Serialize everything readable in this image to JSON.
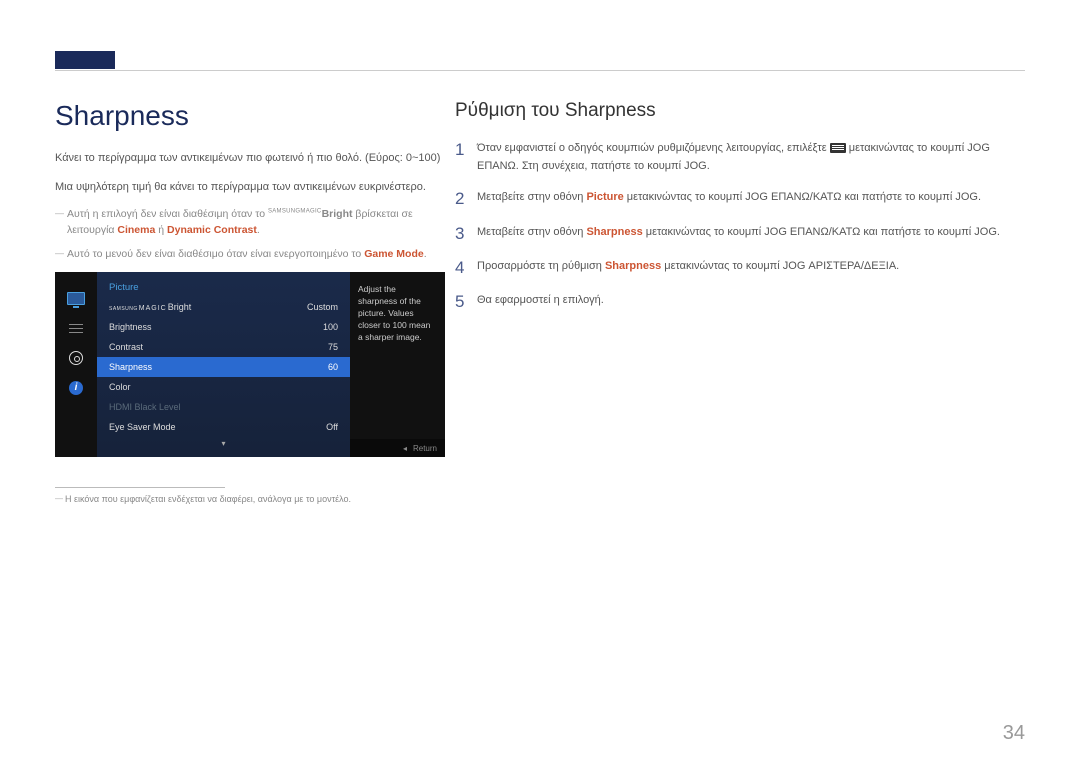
{
  "left": {
    "title": "Sharpness",
    "para1": "Κάνει το περίγραμμα των αντικειμένων πιο φωτεινό ή πιο θολό. (Εύρος: 0~100)",
    "para2": "Μια υψηλότερη τιμή θα κάνει το περίγραμμα των αντικειμένων ευκρινέστερο.",
    "note1_a": "Αυτή η επιλογή δεν είναι διαθέσιμη όταν το ",
    "note1_samsung": "SAMSUNG",
    "note1_magic": "MAGIC",
    "note1_bright": "Bright",
    "note1_b": " βρίσκεται σε λειτουργία ",
    "note1_cinema": "Cinema",
    "note1_or": " ή ",
    "note1_dc": "Dynamic Contrast",
    "note1_end": ".",
    "note2_a": "Αυτό το μενού δεν είναι διαθέσιμο όταν είναι ενεργοποιημένο το ",
    "note2_game": "Game Mode",
    "note2_end": ".",
    "osd": {
      "header": "Picture",
      "items": [
        {
          "label_pre": "",
          "label": "Bright",
          "value": "Custom",
          "magic": true
        },
        {
          "label": "Brightness",
          "value": "100"
        },
        {
          "label": "Contrast",
          "value": "75"
        },
        {
          "label": "Sharpness",
          "value": "60",
          "selected": true
        },
        {
          "label": "Color",
          "value": ""
        },
        {
          "label": "HDMI Black Level",
          "value": "",
          "disabled": true
        },
        {
          "label": "Eye Saver Mode",
          "value": "Off"
        }
      ],
      "help": "Adjust the sharpness of the picture. Values closer to 100 mean a sharper image.",
      "return": "Return",
      "info_i": "i"
    },
    "footnote": "Η εικόνα που εμφανίζεται ενδέχεται να διαφέρει, ανάλογα με το μοντέλο."
  },
  "right": {
    "title": "Ρύθμιση του Sharpness",
    "steps": [
      {
        "n": "1",
        "a": "Όταν εμφανιστεί ο οδηγός κουμπιών ρυθμιζόμενης λειτουργίας, επιλέξτε ",
        "icon": true,
        "b": " μετακινώντας το κουμπί JOG ΕΠΑΝΩ. Στη συνέχεια, πατήστε το κουμπί JOG."
      },
      {
        "n": "2",
        "a": "Μεταβείτε στην οθόνη ",
        "hl": "Picture",
        "b": " μετακινώντας το κουμπί JOG ΕΠΑΝΩ/ΚΑΤΩ και πατήστε το κουμπί JOG."
      },
      {
        "n": "3",
        "a": "Μεταβείτε στην οθόνη ",
        "hl": "Sharpness",
        "b": " μετακινώντας το κουμπί JOG ΕΠΑΝΩ/ΚΑΤΩ και πατήστε το κουμπί JOG."
      },
      {
        "n": "4",
        "a": "Προσαρμόστε τη ρύθμιση ",
        "hl": "Sharpness",
        "b": " μετακινώντας το κουμπί JOG ΑΡΙΣΤΕΡΑ/ΔΕΞΙΑ."
      },
      {
        "n": "5",
        "a": "Θα εφαρμοστεί η επιλογή."
      }
    ]
  },
  "page": "34"
}
